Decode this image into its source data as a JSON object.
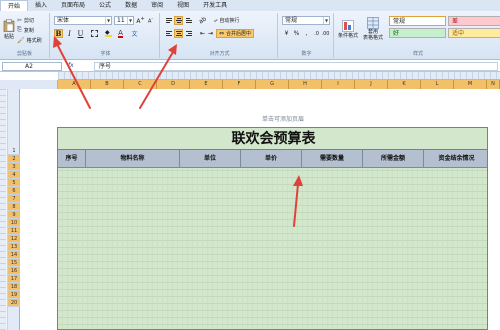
{
  "ribbon_tabs": [
    "开始",
    "插入",
    "页面布局",
    "公式",
    "数据",
    "审阅",
    "视图",
    "开发工具"
  ],
  "clipboard": {
    "paste": "粘贴",
    "cut": "剪切",
    "copy": "复制",
    "format_painter": "格式刷",
    "label": "剪贴板"
  },
  "font": {
    "name": "宋体",
    "size": "11",
    "bold": "B",
    "italic": "I",
    "underline": "U",
    "font_color_glyph": "A",
    "label": "字体"
  },
  "alignment": {
    "wrap": "自动换行",
    "merge": "合并后居中",
    "label": "对齐方式"
  },
  "number": {
    "format": "常规",
    "percent": "%",
    "comma": ",",
    "label": "数字"
  },
  "styles": {
    "conditional_format": "条件格式",
    "table_format": "套用\n表格格式",
    "cells": [
      {
        "text": "常规",
        "color": "#ffffff"
      },
      {
        "text": "差",
        "color": "#ffc7ce"
      },
      {
        "text": "好",
        "color": "#c6efce"
      },
      {
        "text": "适中",
        "color": "#ffeb9c"
      }
    ],
    "label": "样式"
  },
  "formula_bar": {
    "cell_ref": "A2",
    "fx": "fx",
    "content": "序号"
  },
  "columns": [
    "A",
    "B",
    "C",
    "D",
    "E",
    "F",
    "G",
    "H",
    "I",
    "J",
    "K",
    "L",
    "M",
    "N"
  ],
  "rows": [
    "1",
    "2",
    "3",
    "4",
    "5",
    "6",
    "7",
    "8",
    "9",
    "10",
    "11",
    "12",
    "13",
    "14",
    "15",
    "16",
    "17",
    "18",
    "19",
    "20"
  ],
  "page": {
    "header_hint": "单击可添加页眉"
  },
  "sheet": {
    "title": "联欢会预算表",
    "headers": [
      "序号",
      "物料名称",
      "单位",
      "单价",
      "需要数量",
      "所需金额",
      "资金结余情况"
    ]
  },
  "accent": {
    "arrow": "#e0423a",
    "selection": "#f3c06a",
    "table_fill": "#d3e7cc"
  }
}
